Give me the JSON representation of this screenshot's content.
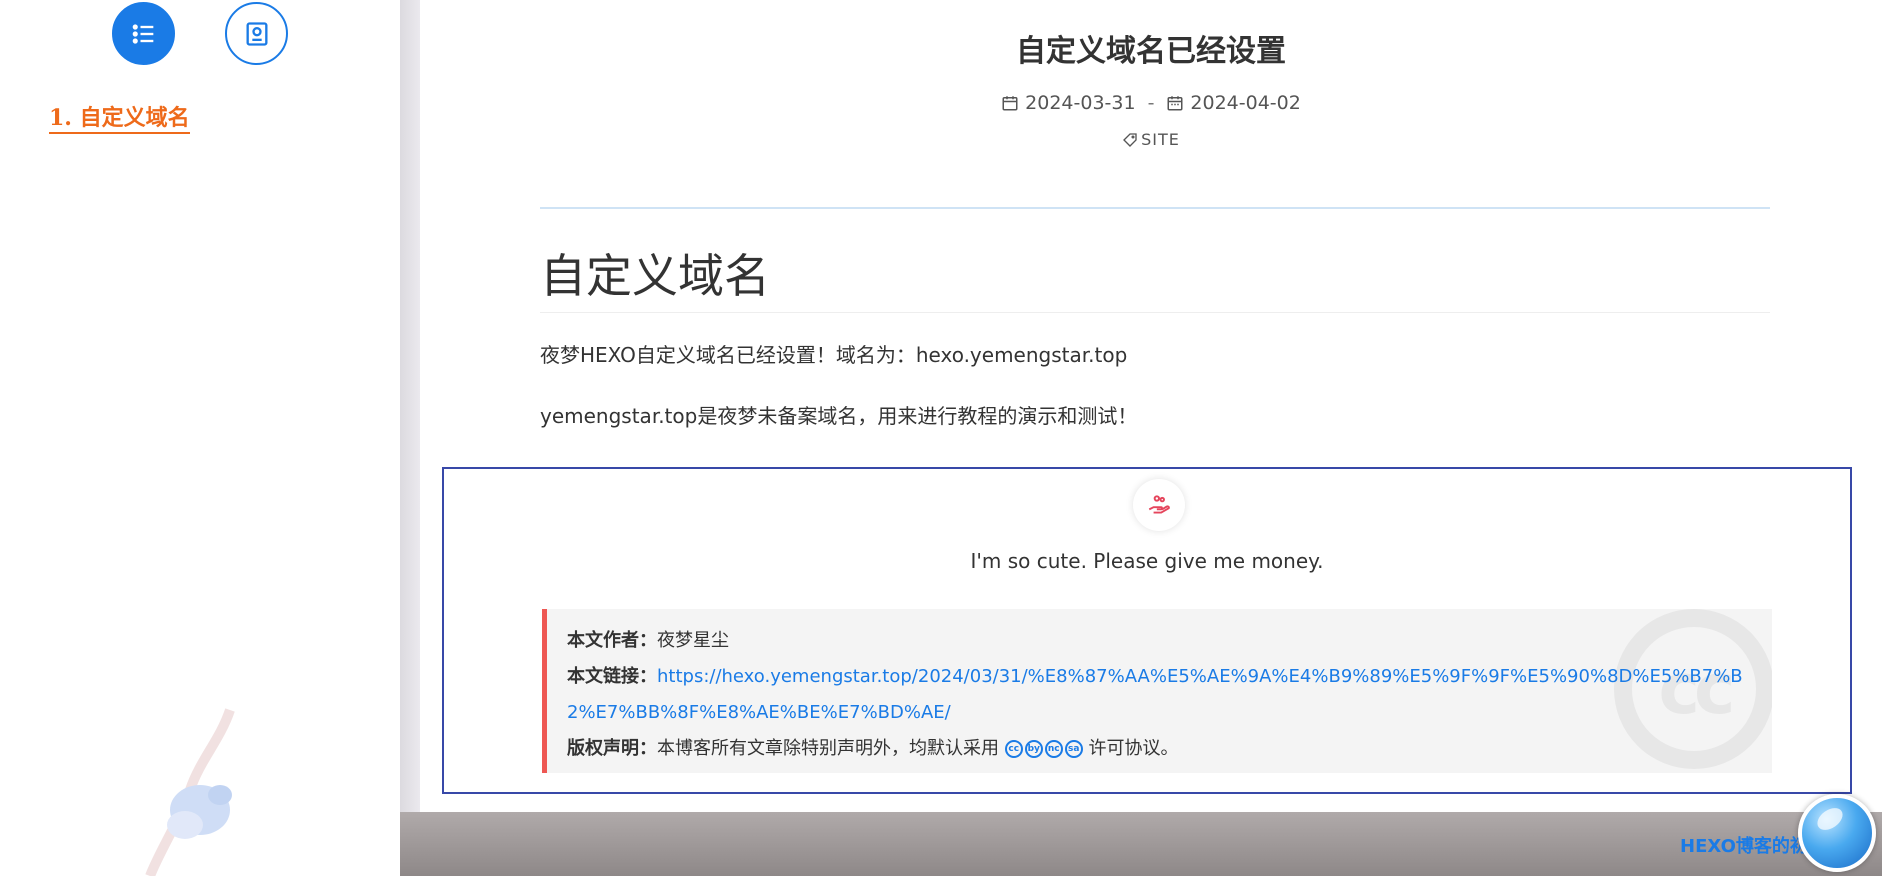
{
  "sidebar": {
    "tabs": [
      {
        "icon": "list-icon",
        "active": true
      },
      {
        "icon": "profile-icon",
        "active": false
      }
    ],
    "toc_item": "1. 自定义域名"
  },
  "post": {
    "title": "自定义域名已经设置",
    "created": "2024-03-31",
    "separator": "-",
    "updated": "2024-04-02",
    "tag": "SITE",
    "section_heading": "自定义域名",
    "paragraphs": [
      "夜梦HEXO自定义域名已经设置！域名为：hexo.yemengstar.top",
      "yemengstar.top是夜梦未备案域名，用来进行教程的演示和测试！"
    ]
  },
  "reward": {
    "icon": "hand-coin-icon",
    "text": "I'm so cute. Please give me money."
  },
  "copyright": {
    "author_label": "本文作者：",
    "author": "夜梦星尘",
    "link_label": "本文链接：",
    "link": "https://hexo.yemengstar.top/2024/03/31/%E8%87%AA%E5%AE%9A%E4%B9%89%E5%9F%9F%E5%90%8D%E5%B7%B2%E7%BB%8F%E8%AE%BE%E7%BD%AE/",
    "license_label": "版权声明：",
    "license_text_before": "本博客所有文章除特别声明外，均默认采用",
    "license_text_after": "许可协议。",
    "cc_icons": [
      "cc",
      "by",
      "nc",
      "sa"
    ],
    "watermark": "cc"
  },
  "footer": {
    "link_text": "HEXO博客的初"
  },
  "colors": {
    "accent": "#1a7be6",
    "toc": "#ee6a1a",
    "reward_border": "#3848a8",
    "copyright_bar": "#ee5753"
  }
}
